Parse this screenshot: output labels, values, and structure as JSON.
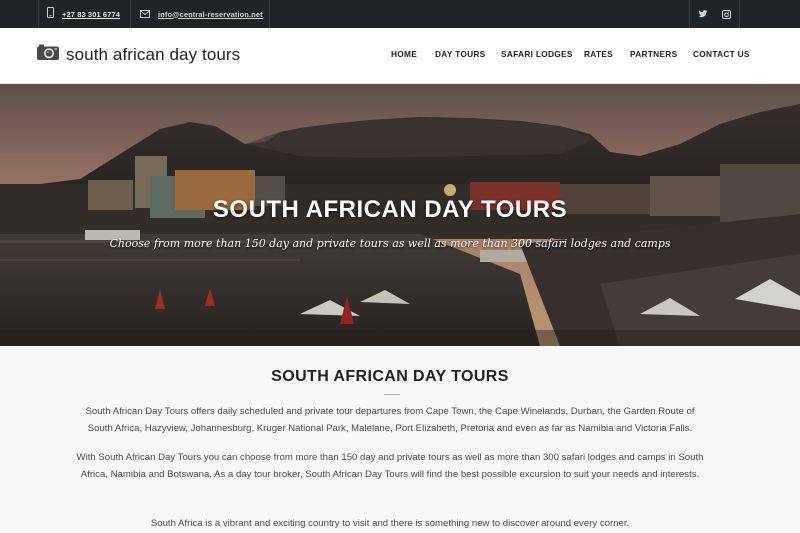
{
  "topbar": {
    "phone": "+27 83 301 6774",
    "email": "info@central-reservation.net",
    "social": [
      "twitter-icon",
      "instagram-icon"
    ]
  },
  "header": {
    "logo_text": "south african day tours",
    "nav": [
      "HOME",
      "DAY TOURS",
      "SAFARI LODGES",
      "RATES",
      "PARTNERS",
      "CONTACT US"
    ]
  },
  "hero": {
    "title": "SOUTH AFRICAN DAY TOURS",
    "subtitle": "Choose from more than 150 day and private tours as well as more than 300 safari lodges and camps"
  },
  "content": {
    "title": "SOUTH AFRICAN DAY TOURS",
    "paragraph1": "South African Day Tours offers daily scheduled and private tour departures from Cape Town, the Cape Winelands, Durban, the Garden Route of South Africa, Hazyview, Johannesburg, Kruger National Park, Malelane, Port Elizabeth, Pretoria and even as far as Namibia and Victoria Falls.",
    "paragraph2": "With South African Day Tours you can choose from more than 150 day and private tours as well as more than 300 safari lodges and camps in South Africa, Namibia and Botswana. As a day tour broker, South African Day Tours will find the best possible excursion to suit your needs and interests.",
    "paragraph3": "South Africa is a vibrant and exciting country to visit and there is something new to discover around every corner."
  },
  "colors": {
    "topbar_bg": "#1f2427",
    "header_bg": "#ffffff",
    "content_bg": "#f8f8f8",
    "text": "#333333"
  }
}
